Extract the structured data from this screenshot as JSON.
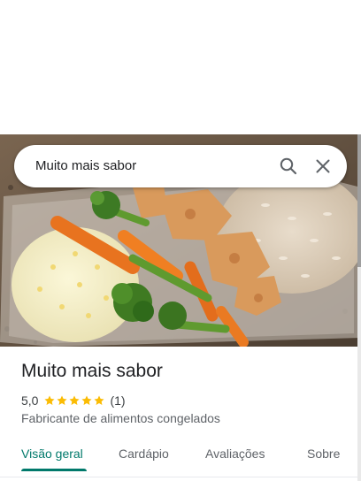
{
  "search": {
    "query": "Muito mais sabor",
    "search_icon": "search-icon",
    "close_icon": "close-icon"
  },
  "hero": {
    "description_icon": "food-photo"
  },
  "place": {
    "name": "Muito mais sabor",
    "rating": "5,0",
    "stars": 5,
    "review_count": "(1)",
    "category": "Fabricante de alimentos congelados"
  },
  "tabs": [
    {
      "label": "Visão geral",
      "active": true
    },
    {
      "label": "Cardápio",
      "active": false
    },
    {
      "label": "Avaliações",
      "active": false
    },
    {
      "label": "Sobre",
      "active": false
    }
  ],
  "colors": {
    "accent": "#00796b",
    "star": "#fbbc04",
    "text_primary": "#202124",
    "text_secondary": "#5f6368"
  }
}
